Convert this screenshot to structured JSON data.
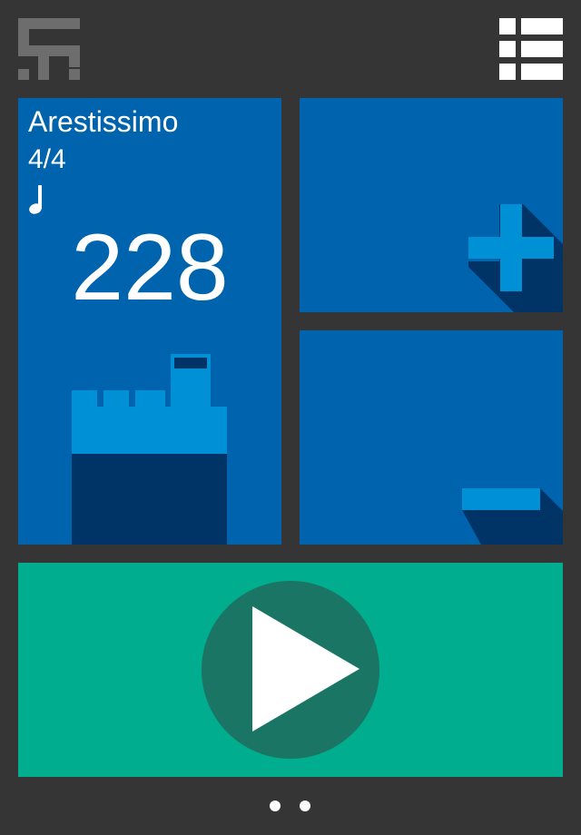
{
  "app": {
    "logo_icon": "st-logo-icon",
    "menu_icon": "list-menu-icon"
  },
  "tempo_tile": {
    "tempo_name": "Arestissimo",
    "time_signature": "4/4",
    "note_icon": "quarter-note-icon",
    "bpm": "228",
    "illustration": "castle-tower-icon"
  },
  "increase_tile": {
    "icon": "plus-icon"
  },
  "decrease_tile": {
    "icon": "minus-icon"
  },
  "play_tile": {
    "icon": "play-icon"
  },
  "pager": {
    "pages": 2
  },
  "colors": {
    "background": "#353535",
    "tile_blue": "#0063ad",
    "accent_light_blue": "#0090d6",
    "shadow_navy": "#003466",
    "play_green": "#00ad8e",
    "play_circle": "#1b7565",
    "logo_gray": "#6d6d6d",
    "white": "#ffffff"
  }
}
